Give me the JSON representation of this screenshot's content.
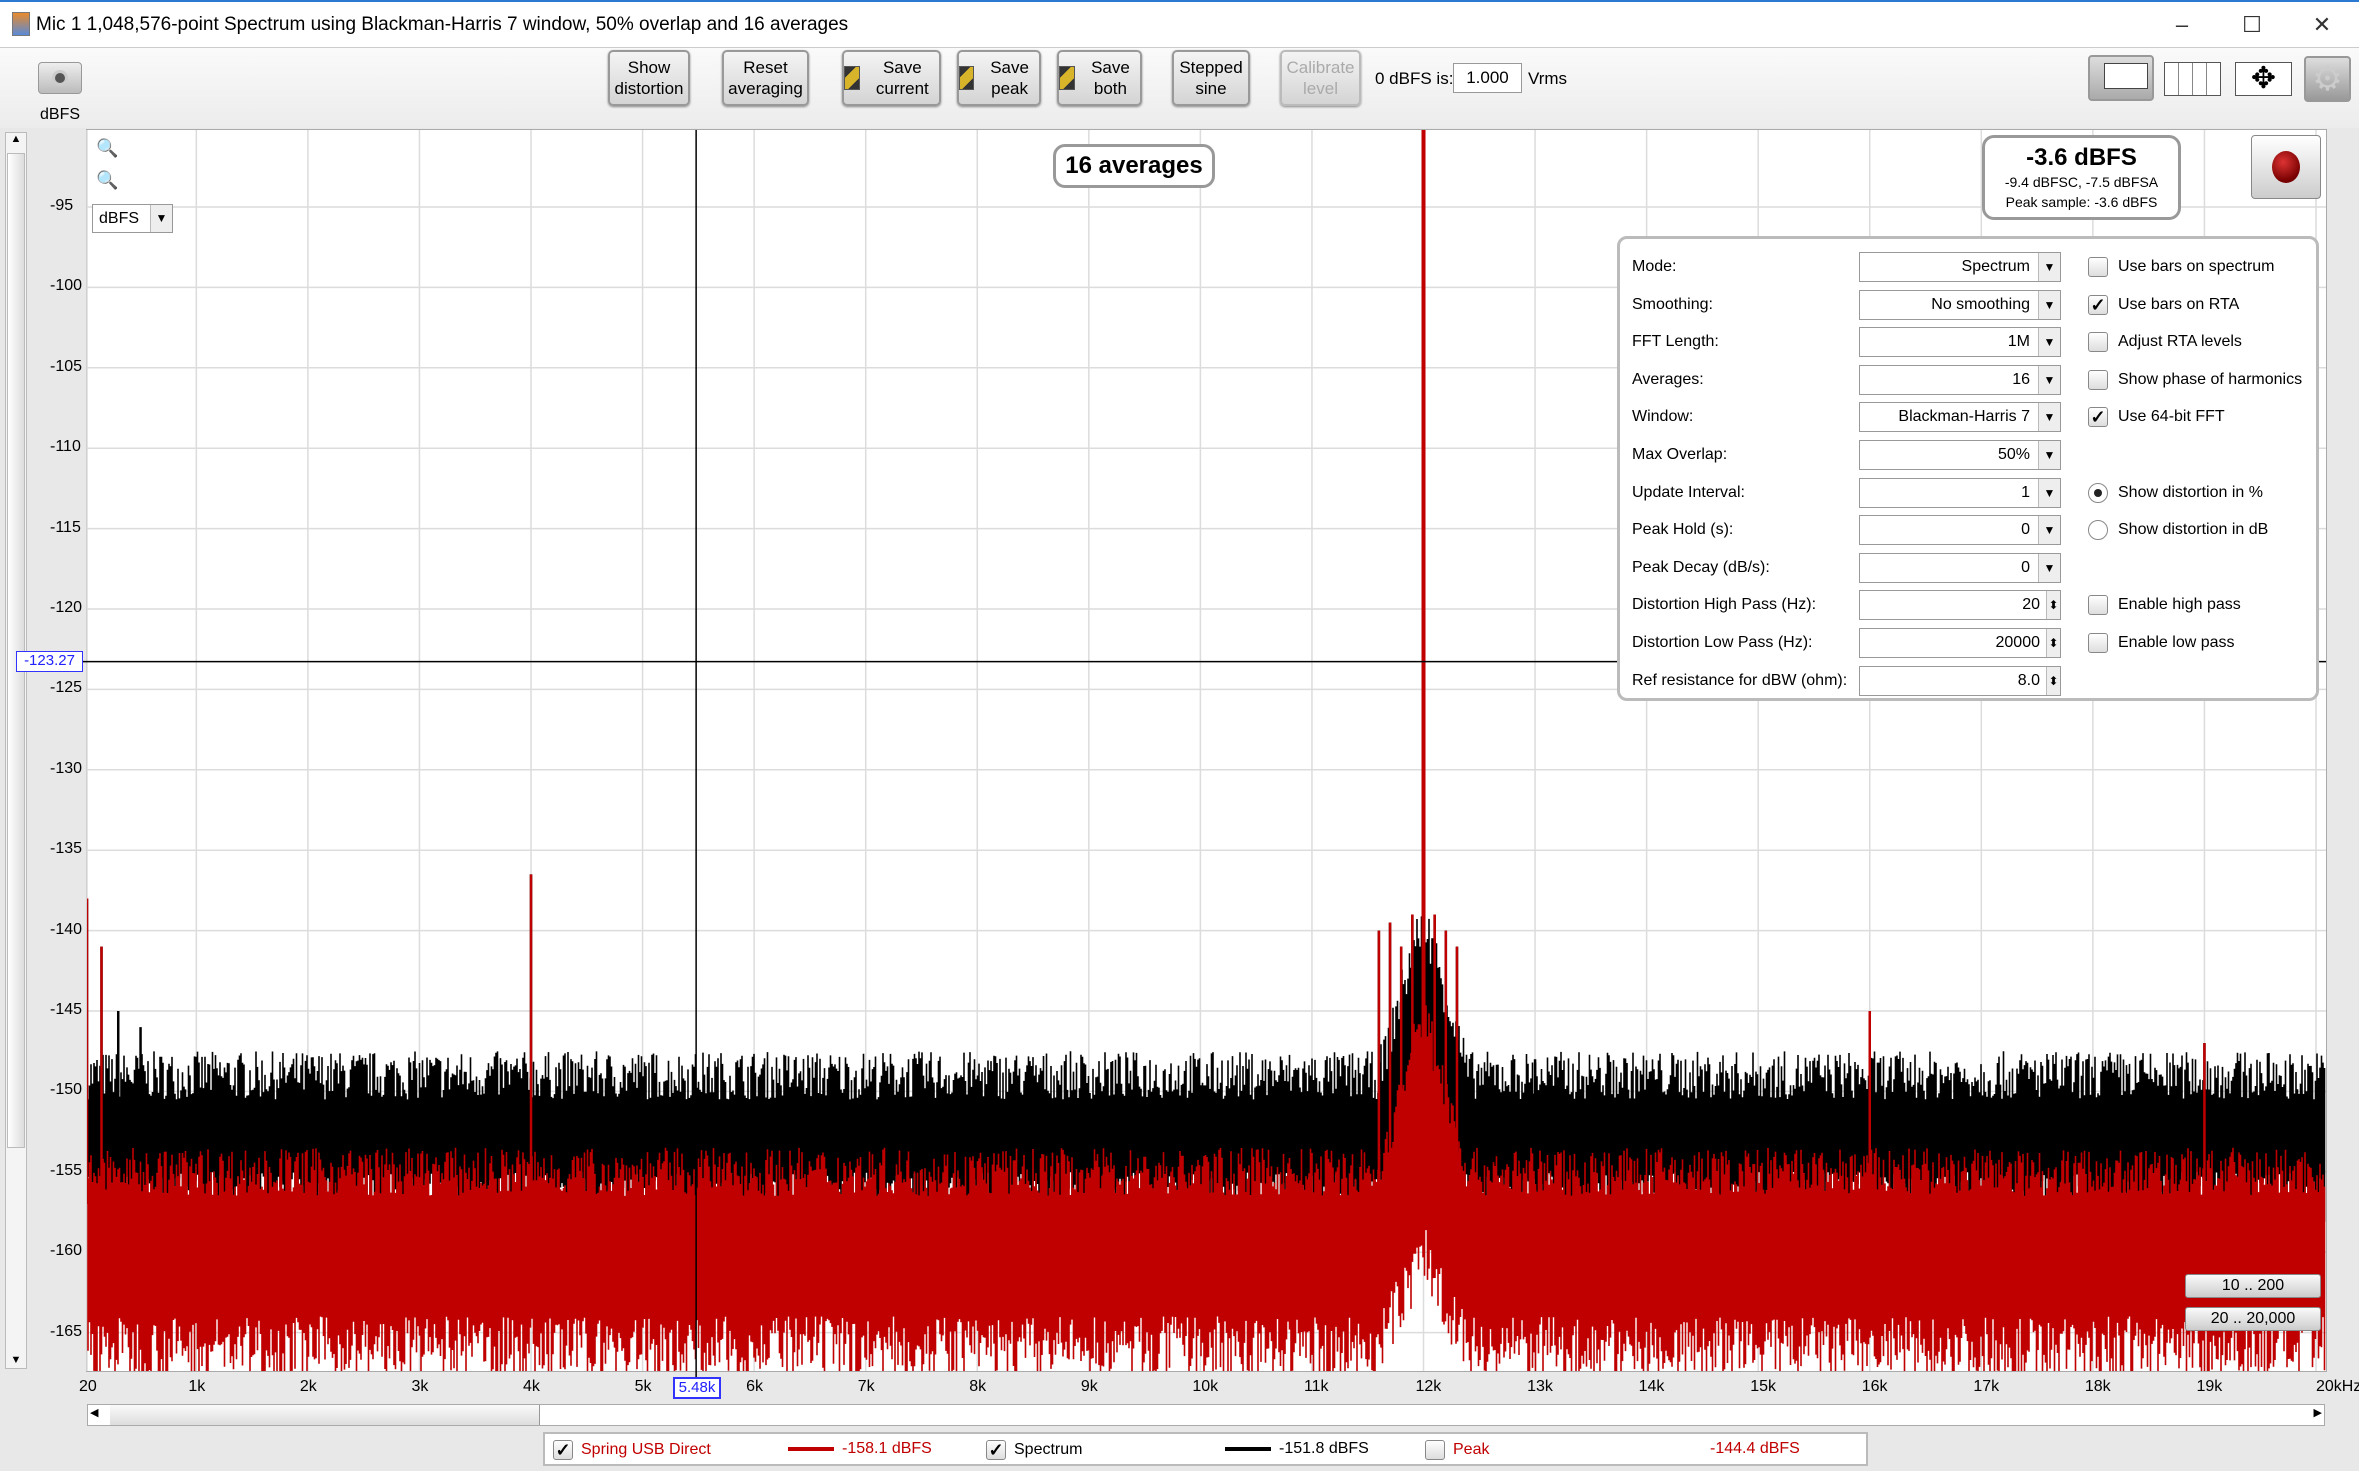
{
  "window": {
    "title": "Mic 1 1,048,576-point Spectrum using Blackman-Harris 7 window, 50% overlap and 16 averages",
    "minimize": "–",
    "maximize": "☐",
    "close": "✕"
  },
  "toolbar": {
    "show_distortion": "Show distortion",
    "reset_averaging": "Reset averaging",
    "save_current": "Save current",
    "save_peak": "Save peak",
    "save_both": "Save both",
    "stepped_sine": "Stepped sine",
    "calibrate_level": "Calibrate level",
    "zero_dbfs_label": "0 dBFS is:",
    "zero_dbfs_value": "1.000",
    "zero_dbfs_unit": "Vrms"
  },
  "plot": {
    "y_unit": "dBFS",
    "unit_select": "dBFS",
    "averages_badge": "16 averages",
    "level": {
      "main": "-3.6 dBFS",
      "sub": "-9.4 dBFSC, -7.5 dBFSA",
      "peak": "Peak sample: -3.6 dBFS"
    },
    "cursor_y": "-123.27",
    "cursor_x": "5.48k",
    "range_buttons": [
      "10 .. 200",
      "20 .. 20,000"
    ]
  },
  "settings": {
    "rows": [
      {
        "label": "Mode:",
        "value": "Spectrum",
        "type": "dropdown"
      },
      {
        "label": "Smoothing:",
        "value": "No  smoothing",
        "type": "dropdown"
      },
      {
        "label": "FFT Length:",
        "value": "1M",
        "type": "dropdown"
      },
      {
        "label": "Averages:",
        "value": "16",
        "type": "dropdown"
      },
      {
        "label": "Window:",
        "value": "Blackman-Harris 7",
        "type": "dropdown"
      },
      {
        "label": "Max Overlap:",
        "value": "50%",
        "type": "dropdown"
      },
      {
        "label": "Update Interval:",
        "value": "1",
        "type": "dropdown"
      },
      {
        "label": "Peak Hold (s):",
        "value": "0",
        "type": "dropdown"
      },
      {
        "label": "Peak Decay (dB/s):",
        "value": "0",
        "type": "dropdown"
      },
      {
        "label": "Distortion High Pass (Hz):",
        "value": "20",
        "type": "spinner"
      },
      {
        "label": "Distortion Low Pass (Hz):",
        "value": "20000",
        "type": "spinner"
      },
      {
        "label": "Ref resistance for dBW (ohm):",
        "value": "8.0",
        "type": "spinner"
      }
    ],
    "options": [
      {
        "label": "Use bars on spectrum",
        "kind": "checkbox",
        "checked": false
      },
      {
        "label": "Use bars on RTA",
        "kind": "checkbox",
        "checked": true
      },
      {
        "label": "Adjust RTA levels",
        "kind": "checkbox",
        "checked": false
      },
      {
        "label": "Show phase of harmonics",
        "kind": "checkbox",
        "checked": false
      },
      {
        "label": "Use 64-bit FFT",
        "kind": "checkbox",
        "checked": true
      },
      null,
      {
        "label": "Show distortion in %",
        "kind": "radio",
        "checked": true
      },
      {
        "label": "Show distortion in dB",
        "kind": "radio",
        "checked": false
      },
      null,
      {
        "label": "Enable high pass",
        "kind": "checkbox",
        "checked": false
      },
      {
        "label": "Enable low pass",
        "kind": "checkbox",
        "checked": false
      }
    ]
  },
  "legend": [
    {
      "label": "Spring USB Direct",
      "value": "-158.1 dBFS",
      "checked": true,
      "color": "#c00000"
    },
    {
      "label": "Spectrum",
      "value": "-151.8 dBFS",
      "checked": true,
      "color": "#000000"
    },
    {
      "label": "Peak",
      "value": "-144.4 dBFS",
      "checked": false,
      "color": "#c00000"
    }
  ],
  "chart_data": {
    "type": "line",
    "xlabel": "",
    "ylabel": "dBFS",
    "xlim": [
      20,
      20000
    ],
    "ylim": [
      -167,
      -90
    ],
    "x_ticks": [
      "20",
      "1k",
      "2k",
      "3k",
      "4k",
      "5k",
      "6k",
      "7k",
      "8k",
      "9k",
      "10k",
      "11k",
      "12k",
      "13k",
      "14k",
      "15k",
      "16k",
      "17k",
      "18k",
      "19k",
      "20kHz"
    ],
    "y_ticks": [
      -95,
      -100,
      -105,
      -110,
      -115,
      -120,
      -125,
      -130,
      -135,
      -140,
      -145,
      -150,
      -155,
      -160,
      -165
    ],
    "grid": true,
    "series": [
      {
        "name": "Spectrum",
        "color": "#000000",
        "floor_range": [
          -157,
          -149
        ],
        "peaks": [
          [
            20,
            -138
          ],
          [
            150,
            -141
          ],
          [
            300,
            -145
          ],
          [
            500,
            -146
          ],
          [
            4000,
            -136.5
          ],
          [
            5500,
            -150
          ],
          [
            11600,
            -140
          ],
          [
            11700,
            -139.5
          ],
          [
            11800,
            -141
          ],
          [
            11900,
            -139
          ],
          [
            12000,
            -3.6
          ],
          [
            12100,
            -139
          ],
          [
            12200,
            -140
          ],
          [
            12300,
            -141
          ],
          [
            13000,
            -148
          ],
          [
            16000,
            -145
          ],
          [
            19000,
            -147
          ]
        ]
      },
      {
        "name": "Spring USB Direct",
        "color": "#c00000",
        "floor_range": [
          -166,
          -155
        ],
        "peaks": [
          [
            20,
            -138
          ],
          [
            150,
            -141
          ],
          [
            4000,
            -136.5
          ],
          [
            11600,
            -140
          ],
          [
            11700,
            -139.5
          ],
          [
            11800,
            -141
          ],
          [
            11900,
            -139
          ],
          [
            12000,
            -3.6
          ],
          [
            12100,
            -139
          ],
          [
            12200,
            -140
          ],
          [
            12300,
            -141
          ],
          [
            16000,
            -145
          ],
          [
            19000,
            -147
          ]
        ]
      }
    ]
  }
}
